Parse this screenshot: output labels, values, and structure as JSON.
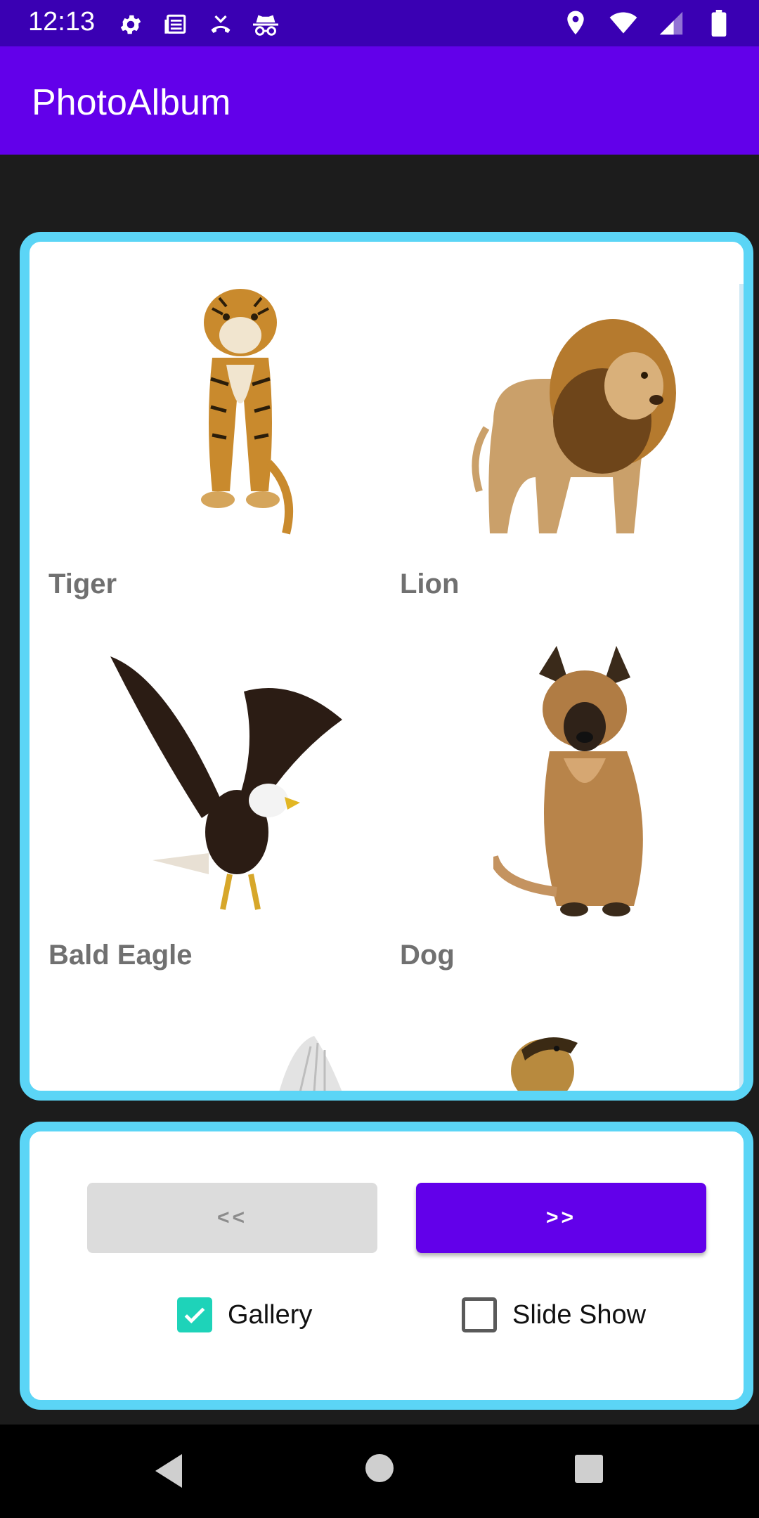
{
  "status_bar": {
    "time": "12:13",
    "left_icons": [
      "gear-icon",
      "news-icon",
      "call-forward-icon",
      "incognito-icon"
    ],
    "right_icons": [
      "location-icon",
      "wifi-icon",
      "signal-icon",
      "battery-icon"
    ]
  },
  "app_bar": {
    "title": "PhotoAlbum"
  },
  "colors": {
    "accent": "#6200ea",
    "status_bar": "#3a00b3",
    "card_border": "#5bd5f6",
    "checkbox_checked": "#1ed3b9"
  },
  "gallery": {
    "items": [
      {
        "label": "Tiger"
      },
      {
        "label": "Lion"
      },
      {
        "label": "Bald Eagle"
      },
      {
        "label": "Dog"
      }
    ]
  },
  "controls": {
    "prev_label": "<<",
    "next_label": ">>",
    "gallery_label": "Gallery",
    "gallery_checked": true,
    "slideshow_label": "Slide Show",
    "slideshow_checked": false
  },
  "nav": {
    "icons": [
      "back-icon",
      "home-icon",
      "recents-icon"
    ]
  }
}
